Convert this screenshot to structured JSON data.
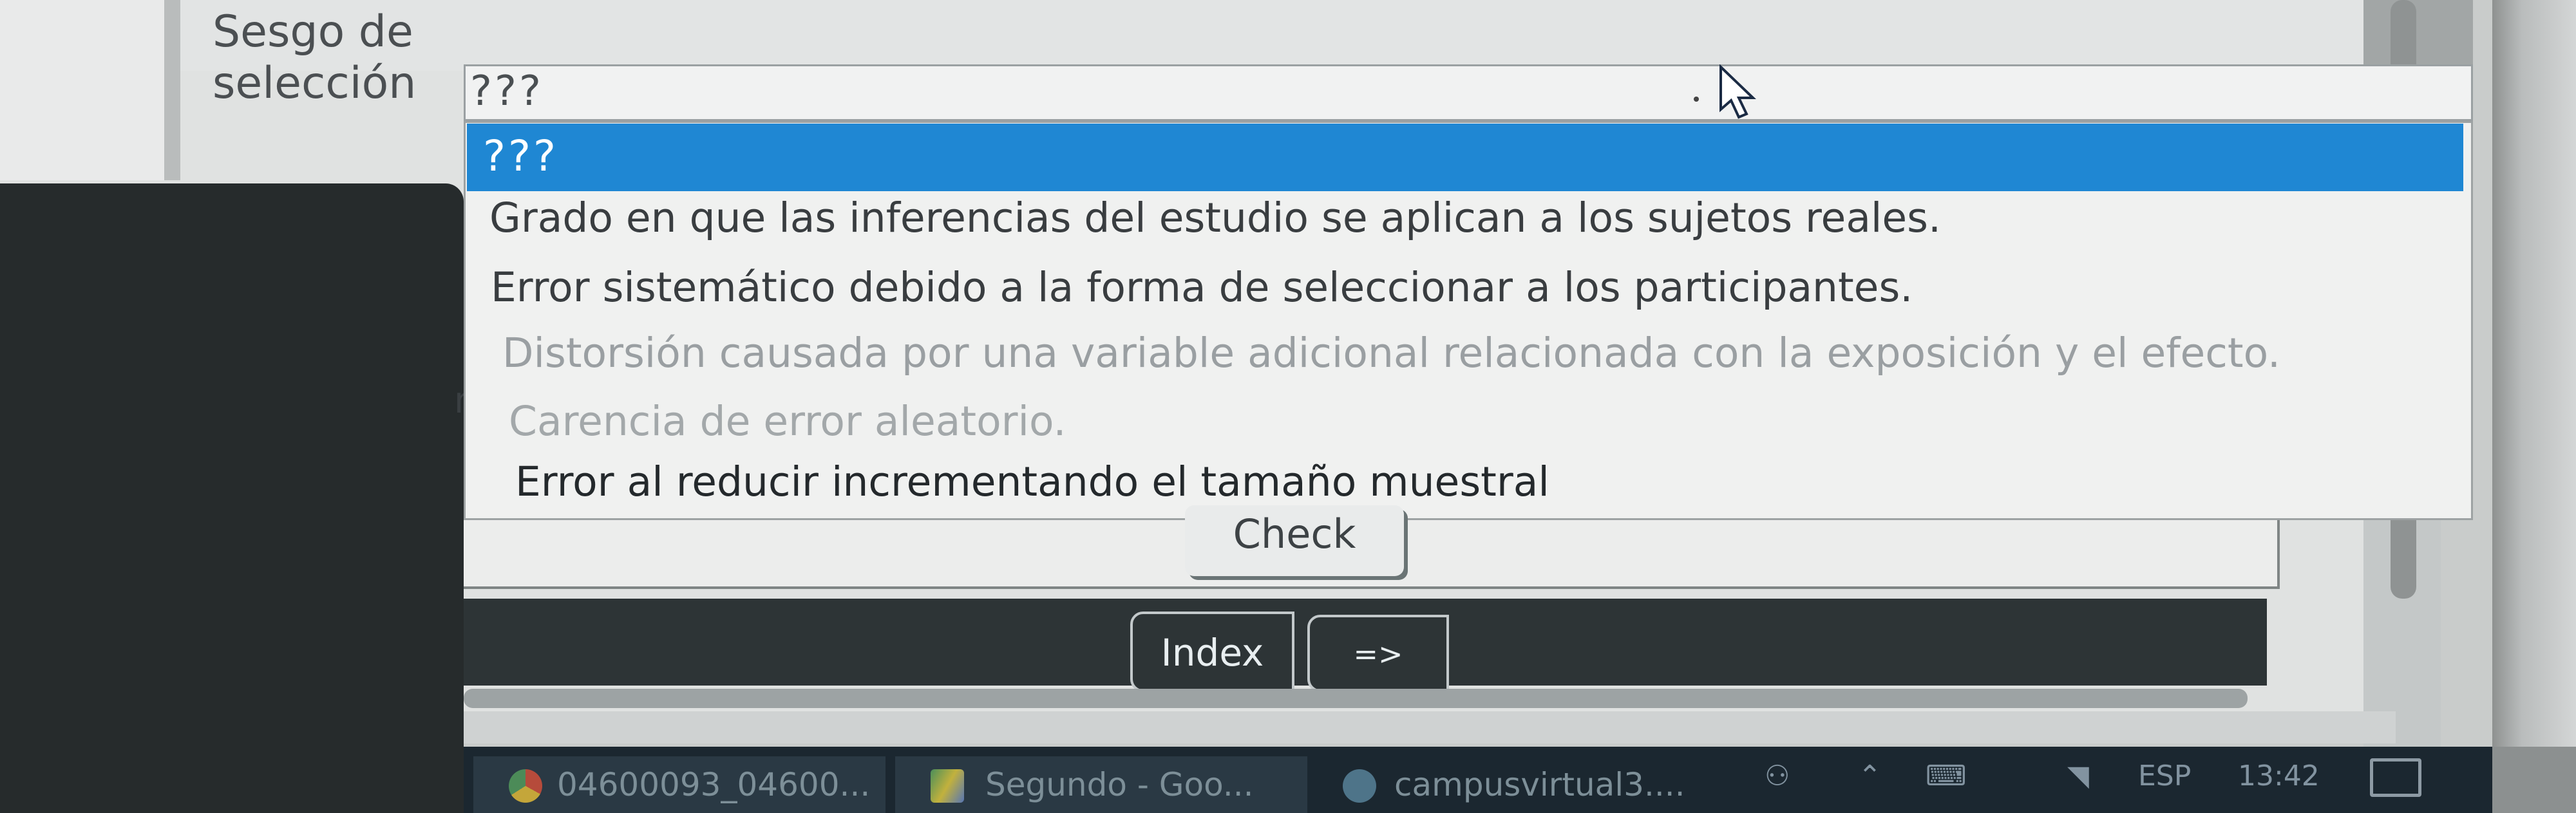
{
  "question": {
    "label": "Sesgo de selección"
  },
  "select": {
    "value": "???"
  },
  "dropdown": {
    "options": [
      "???",
      "Grado en que las inferencias del estudio se aplican a los sujetos reales.",
      "Error sistemático debido a la forma de seleccionar a los participantes.",
      "Distorsión causada por una variable adicional relacionada con la exposición y el efecto.",
      "Carencia de error aleatorio.",
      "Error al reducir incrementando el tamaño muestral"
    ],
    "highlighted_index": 0
  },
  "page_fragment": "n",
  "actions": {
    "check_label": "Check"
  },
  "nav": {
    "index_label": "Index",
    "next_label": "=>"
  },
  "taskbar": {
    "tasks": [
      {
        "label": "04600093_04600...",
        "icon": "chrome-icon"
      },
      {
        "label": "Segundo - Goo...",
        "icon": "google-drive-icon"
      },
      {
        "label": "campusvirtual3....",
        "icon": "moodle-icon"
      }
    ],
    "tray": {
      "language": "ESP",
      "time": "13:42"
    }
  },
  "colors": {
    "highlight": "#1f87d3",
    "taskbar": "#1b2730",
    "navbar": "#2d3436"
  }
}
